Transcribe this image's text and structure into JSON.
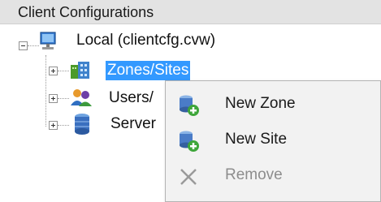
{
  "header": {
    "title": "Client Configurations"
  },
  "tree": {
    "root": {
      "label": "Local (clientcfg.cvw)",
      "icon": "computer-icon"
    },
    "children": [
      {
        "label": "Zones/Sites",
        "icon": "building-icon",
        "selected": true
      },
      {
        "label": "Users/",
        "icon": "users-icon",
        "selected": false
      },
      {
        "label": "Server",
        "icon": "server-icon",
        "selected": false
      }
    ]
  },
  "context_menu": {
    "items": [
      {
        "label": "New Zone",
        "icon": "database-add-icon",
        "enabled": true
      },
      {
        "label": "New Site",
        "icon": "database-add-icon",
        "enabled": true
      },
      {
        "label": "Remove",
        "icon": "remove-x-icon",
        "enabled": false
      }
    ]
  },
  "colors": {
    "selection": "#3399ff",
    "header_bg": "#e3e3e3",
    "menu_bg": "#f2f2f2"
  }
}
